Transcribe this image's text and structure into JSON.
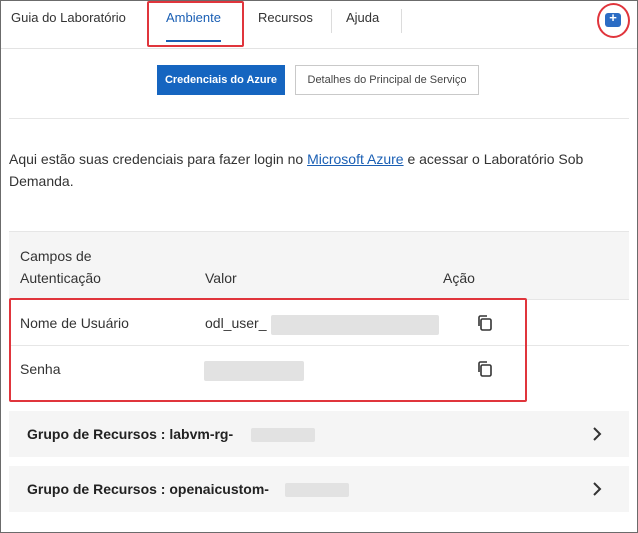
{
  "tabs": [
    {
      "label": "Guia do Laboratório",
      "active": false
    },
    {
      "label": "Ambiente",
      "active": true
    },
    {
      "label": "Recursos",
      "active": false
    },
    {
      "label": "Ajuda",
      "active": false
    }
  ],
  "corner_icon": "plus-square-icon",
  "buttons": {
    "azure_credentials": "Credenciais do Azure",
    "service_principal": "Detalhes do Principal de Serviço"
  },
  "intro": {
    "before": "Aqui estão suas credenciais para fazer login no ",
    "link": "Microsoft Azure",
    "after": " e acessar o Laboratório Sob Demanda."
  },
  "table": {
    "headers": [
      "Campos de Autenticação",
      "Valor",
      "Ação"
    ],
    "rows": [
      {
        "field": "Nome de Usuário",
        "value_prefix": "odl_user_",
        "action_icon": "copy-icon"
      },
      {
        "field": "Senha",
        "value_prefix": "",
        "action_icon": "copy-icon"
      }
    ]
  },
  "resource_groups": [
    {
      "label": "Grupo de Recursos : labvm-rg-"
    },
    {
      "label": "Grupo de Recursos : openaicustom-"
    }
  ],
  "colors": {
    "accent": "#1565c0",
    "highlight": "#e0353c"
  }
}
